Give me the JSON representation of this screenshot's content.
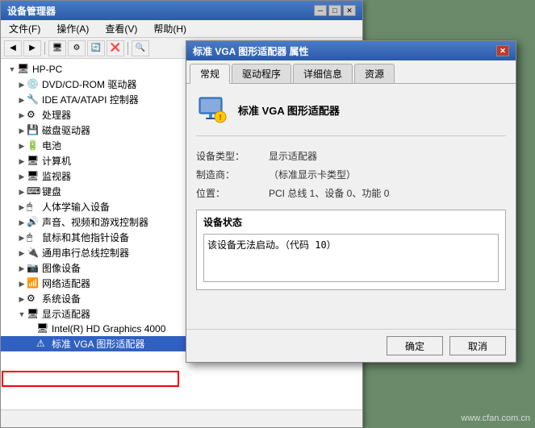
{
  "deviceManager": {
    "title": "设备管理器",
    "menuItems": [
      {
        "label": "文件(F)"
      },
      {
        "label": "操作(A)"
      },
      {
        "label": "查看(V)"
      },
      {
        "label": "帮助(H)"
      }
    ],
    "treeNodes": [
      {
        "id": "hp-pc",
        "label": "HP-PC",
        "level": 0,
        "icon": "🖥",
        "expanded": true
      },
      {
        "id": "dvd",
        "label": "DVD/CD-ROM 驱动器",
        "level": 1,
        "icon": "💿",
        "expanded": false
      },
      {
        "id": "ide",
        "label": "IDE ATA/ATAPI 控制器",
        "level": 1,
        "icon": "🔧",
        "expanded": false
      },
      {
        "id": "processor",
        "label": "处理器",
        "level": 1,
        "icon": "⚙",
        "expanded": false
      },
      {
        "id": "disk",
        "label": "磁盘驱动器",
        "level": 1,
        "icon": "💾",
        "expanded": false
      },
      {
        "id": "battery",
        "label": "电池",
        "level": 1,
        "icon": "🔋",
        "expanded": false
      },
      {
        "id": "computer",
        "label": "计算机",
        "level": 1,
        "icon": "🖥",
        "expanded": false
      },
      {
        "id": "monitor",
        "label": "监视器",
        "level": 1,
        "icon": "🖥",
        "expanded": false
      },
      {
        "id": "keyboard",
        "label": "键盘",
        "level": 1,
        "icon": "⌨",
        "expanded": false
      },
      {
        "id": "hid",
        "label": "人体学输入设备",
        "level": 1,
        "icon": "🖱",
        "expanded": false
      },
      {
        "id": "sound",
        "label": "声音、视频和游戏控制器",
        "level": 1,
        "icon": "🔊",
        "expanded": false
      },
      {
        "id": "mouse",
        "label": "鼠标和其他指针设备",
        "level": 1,
        "icon": "🖱",
        "expanded": false
      },
      {
        "id": "comport",
        "label": "通用串行总线控制器",
        "level": 1,
        "icon": "🔌",
        "expanded": false
      },
      {
        "id": "imaging",
        "label": "图像设备",
        "level": 1,
        "icon": "📷",
        "expanded": false
      },
      {
        "id": "network",
        "label": "网络适配器",
        "level": 1,
        "icon": "📶",
        "expanded": false
      },
      {
        "id": "system",
        "label": "系统设备",
        "level": 1,
        "icon": "⚙",
        "expanded": false
      },
      {
        "id": "display",
        "label": "显示适配器",
        "level": 1,
        "icon": "🖥",
        "expanded": true
      },
      {
        "id": "intel",
        "label": "Intel(R) HD Graphics 4000",
        "level": 2,
        "icon": "🖥",
        "expanded": false
      },
      {
        "id": "vga",
        "label": "标准 VGA 图形适配器",
        "level": 2,
        "icon": "⚠",
        "expanded": false,
        "selected": true,
        "highlighted": true
      }
    ]
  },
  "propertiesDialog": {
    "title": "标准 VGA 图形适配器 属性",
    "tabs": [
      {
        "label": "常规",
        "active": true
      },
      {
        "label": "驱动程序"
      },
      {
        "label": "详细信息"
      },
      {
        "label": "资源"
      }
    ],
    "deviceName": "标准 VGA 图形适配器",
    "properties": [
      {
        "key": "设备类型：",
        "value": "显示适配器"
      },
      {
        "key": "制造商：",
        "value": "（标准显示卡类型）"
      },
      {
        "key": "位置：",
        "value": "PCI 总线 1、设备 0、功能 0"
      }
    ],
    "statusSection": {
      "title": "设备状态",
      "text": "该设备无法启动。（代码 10）"
    },
    "buttons": [
      {
        "label": "确定",
        "id": "ok"
      },
      {
        "label": "取消",
        "id": "cancel"
      }
    ]
  },
  "watermark": "www.cfan.com.cn"
}
